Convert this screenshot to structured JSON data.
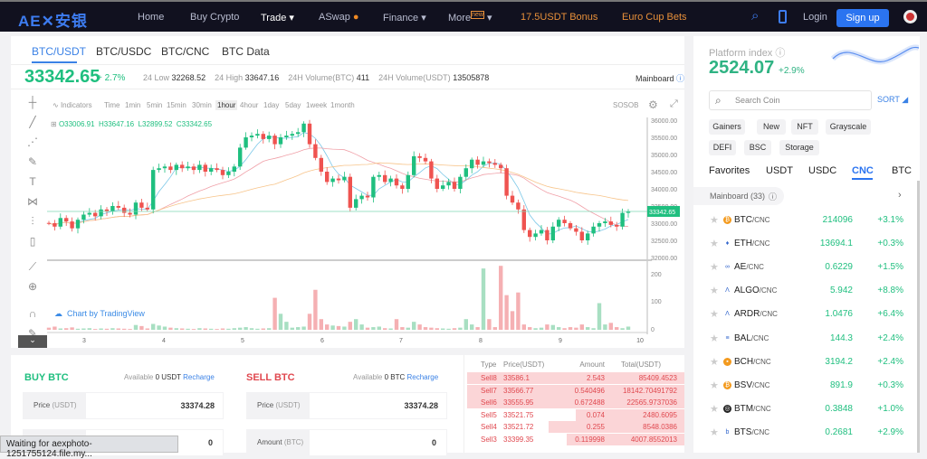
{
  "nav": {
    "logo": "AE✕安银",
    "items": [
      "Home",
      "Buy Crypto",
      "Trade ▾",
      "ASwap",
      "Finance ▾",
      "More",
      "17.5USDT Bonus",
      "Euro Cup Bets"
    ],
    "more_badge": "new",
    "login": "Login",
    "signup": "Sign up"
  },
  "tabs": [
    "BTC/USDT",
    "BTC/USDC",
    "BTC/CNC",
    "BTC Data"
  ],
  "ticker": {
    "price": "33342.65",
    "change": "+ 2.7%",
    "low_label": "24 Low",
    "low": "32268.52",
    "high_label": "24 High",
    "high": "33647.16",
    "vol_btc_label": "24H Volume(BTC)",
    "vol_btc": "411",
    "vol_usdt_label": "24H Volume(USDT)",
    "vol_usdt": "13505878",
    "mainboard": "Mainboard"
  },
  "chart_toolbar": {
    "indicators": "Indicators",
    "timeframes": [
      "Time",
      "1min",
      "5min",
      "15min",
      "30min",
      "1hour",
      "4hour",
      "1day",
      "5day",
      "1week",
      "1month"
    ],
    "selected": "1hour",
    "sosob": "SOSOB"
  },
  "ohlc": {
    "o": "O33006.91",
    "h": "H33647.16",
    "l": "L32899.52",
    "c": "C33342.65"
  },
  "tradingview": "Chart by TradingView",
  "chart_data": {
    "type": "candlestick",
    "x_ticks": [
      "3",
      "4",
      "5",
      "6",
      "7",
      "8",
      "9",
      "10"
    ],
    "y_ticks": [
      "36000.00",
      "35500.00",
      "35000.00",
      "34500.00",
      "34000.00",
      "33500.00",
      "33000.00",
      "32500.00",
      "32000.00"
    ],
    "last_price_label": "33342.65",
    "volume_ticks": [
      "200",
      "100",
      "0"
    ],
    "ylim": [
      32000,
      36000
    ],
    "volume_ylim": [
      0,
      250
    ],
    "closes": [
      33000,
      32900,
      33150,
      33050,
      32850,
      33100,
      33250,
      33300,
      33200,
      33400,
      33350,
      33500,
      33450,
      33300,
      33250,
      33600,
      33450,
      33400,
      34550,
      34600,
      34650,
      34550,
      34700,
      34600,
      34650,
      34550,
      34700,
      34500,
      34600,
      34550,
      34400,
      34500,
      34650,
      35200,
      35500,
      35550,
      35600,
      35450,
      35550,
      35300,
      35500,
      35550,
      35600,
      35650,
      35900,
      35300,
      34900,
      34500,
      34200,
      34300,
      34250,
      34350,
      33450,
      33700,
      33800,
      33750,
      34350,
      34400,
      34200,
      34300,
      34100,
      34000,
      34400,
      34950,
      34900,
      34800,
      34300,
      34000,
      34100,
      34200,
      34000,
      34350,
      34600,
      34850,
      34700,
      34800,
      34750,
      34700,
      34600,
      33800,
      33600,
      33400,
      32800,
      32600,
      32700,
      32800,
      32500,
      32900,
      33100,
      33000,
      32850,
      32750,
      32500,
      32700,
      32900,
      33000,
      33050,
      32950,
      32900,
      33300,
      33342.65
    ],
    "volumes": [
      8,
      12,
      5,
      6,
      9,
      4,
      5,
      6,
      3,
      5,
      4,
      6,
      5,
      4,
      3,
      18,
      14,
      5,
      22,
      16,
      12,
      8,
      6,
      5,
      4,
      3,
      6,
      5,
      4,
      3,
      5,
      4,
      6,
      8,
      10,
      6,
      4,
      5,
      6,
      120,
      60,
      30,
      8,
      10,
      12,
      60,
      150,
      40,
      20,
      16,
      14,
      12,
      30,
      40,
      20,
      8,
      10,
      12,
      6,
      5,
      40,
      10,
      8,
      30,
      20,
      10,
      8,
      6,
      5,
      4,
      6,
      8,
      40,
      20,
      10,
      230,
      40,
      10,
      240,
      130,
      70,
      140,
      20,
      10,
      6,
      8,
      20,
      18,
      10,
      6,
      10,
      8,
      20,
      10,
      6,
      100,
      20,
      26,
      10,
      6,
      12
    ]
  },
  "buy": {
    "title": "BUY BTC",
    "available_label": "Available",
    "available": "0 USDT",
    "recharge": "Recharge",
    "price_label": "Price",
    "price_unit": "(USDT)",
    "price": "33374.28",
    "amount": "0"
  },
  "sell": {
    "title": "SELL BTC",
    "available_label": "Available",
    "available": "0 BTC",
    "recharge": "Recharge",
    "price_label": "Price",
    "price_unit": "(USDT)",
    "price": "33374.28",
    "amount_label": "Amount",
    "amount_unit": "(BTC)",
    "amount": "0"
  },
  "orderbook": {
    "headers": [
      "Type",
      "Price(USDT)",
      "Amount",
      "Total(USDT)"
    ],
    "rows": [
      [
        "Sell8",
        "33586.1",
        "2.543",
        "85409.4523"
      ],
      [
        "Sell7",
        "33566.77",
        "0.540496",
        "18142.70491792"
      ],
      [
        "Sell6",
        "33555.95",
        "0.672488",
        "22565.9737036"
      ],
      [
        "Sell5",
        "33521.75",
        "0.074",
        "2480.6095"
      ],
      [
        "Sell4",
        "33521.72",
        "0.255",
        "8548.0386"
      ],
      [
        "Sell3",
        "33399.35",
        "0.119998",
        "4007.8552013"
      ]
    ]
  },
  "status_bar": "Waiting for aexphoto-1251755124.file.my...",
  "platform": {
    "label": "Platform index",
    "value": "2524.07",
    "change": "+2.9%"
  },
  "search": {
    "placeholder": "Search Coin",
    "sort": "SORT"
  },
  "chips": [
    "Gainers",
    "New",
    "NFT",
    "Grayscale",
    "DEFI",
    "BSC",
    "Storage"
  ],
  "market_tabs": [
    "Favorites",
    "USDT",
    "USDC",
    "CNC",
    "BTC"
  ],
  "mainboard_label": "Mainboard (33)",
  "markets": [
    [
      "BTC",
      "/CNC",
      "214096",
      "+3.1%"
    ],
    [
      "ETH",
      "/CNC",
      "13694.1",
      "+0.3%"
    ],
    [
      "AE",
      "/CNC",
      "0.6229",
      "+1.5%"
    ],
    [
      "ALGO",
      "/CNC",
      "5.942",
      "+8.8%"
    ],
    [
      "ARDR",
      "/CNC",
      "1.0476",
      "+6.4%"
    ],
    [
      "BAL",
      "/CNC",
      "144.3",
      "+2.4%"
    ],
    [
      "BCH",
      "/CNC",
      "3194.2",
      "+2.4%"
    ],
    [
      "BSV",
      "/CNC",
      "891.9",
      "+0.3%"
    ],
    [
      "BTM",
      "/CNC",
      "0.3848",
      "+1.0%"
    ],
    [
      "BTS",
      "/CNC",
      "0.2681",
      "+2.9%"
    ]
  ],
  "colors": {
    "up": "#1fbf7f",
    "down": "#ef5350",
    "accent": "#2b74f0",
    "nav_bg": "#11111f",
    "bonus": "#e8903a"
  }
}
